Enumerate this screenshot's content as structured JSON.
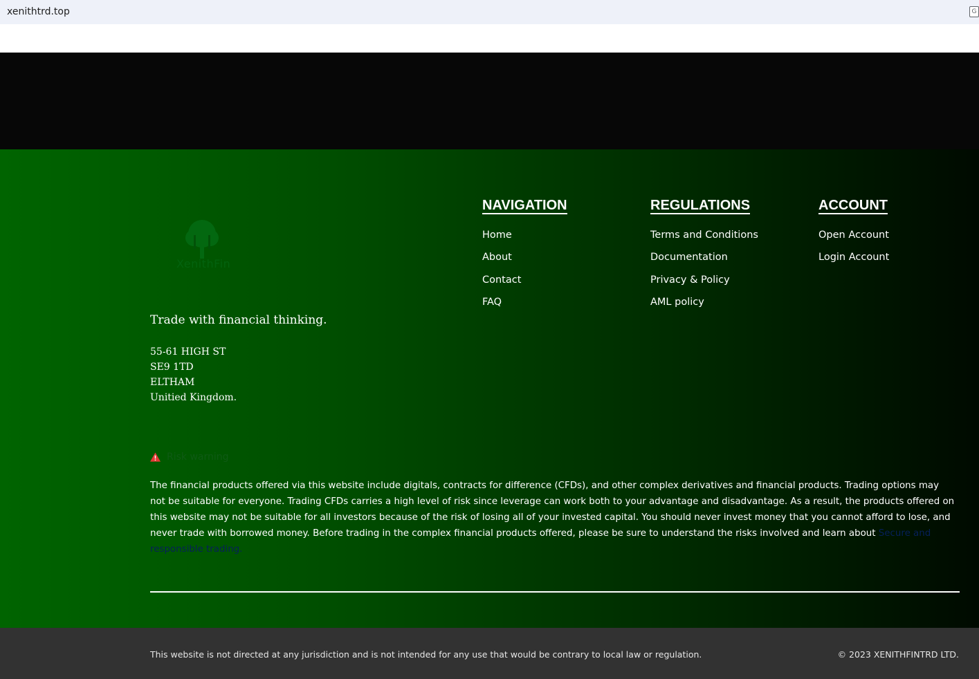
{
  "browser": {
    "url": "xenithtrd.top"
  },
  "footer": {
    "logo_text": "XenithFin",
    "tagline": "Trade with financial thinking.",
    "address": [
      "55-61 HIGH ST",
      "SE9 1TD",
      "ELTHAM",
      "Unitied Kingdom."
    ],
    "navigation": {
      "heading": "NAVIGATION",
      "items": [
        "Home",
        "About",
        "Contact",
        "FAQ"
      ]
    },
    "regulations": {
      "heading": "REGULATIONS",
      "items": [
        "Terms and Conditions",
        "Documentation",
        "Privacy & Policy",
        "AML policy"
      ]
    },
    "account": {
      "heading": "ACCOUNT",
      "items": [
        "Open Account",
        "Login Account"
      ]
    },
    "risk": {
      "heading": "Risk warning",
      "text": "The financial products offered via this website include digitals, contracts for difference (CFDs), and other complex derivatives and financial products. Trading options may not be suitable for everyone. Trading CFDs carries a high level of risk since leverage can work both to your advantage and disadvantage. As a result, the products offered on this website may not be suitable for all investors because of the risk of losing all of your invested capital. You should never invest money that you cannot afford to lose, and never trade with borrowed money. Before trading in the complex financial products offered, please be sure to understand the risks involved and learn about ",
      "link_text": "Secure and responsible trading."
    }
  },
  "bottom_bar": {
    "disclaimer": "This website is not directed at any jurisdiction and is not intended for any use that would be contrary to local law or regulation.",
    "copyright": "© 2023 XENITHFINTRD LTD."
  },
  "colors": {
    "footer_gradient_start": "#006400",
    "footer_gradient_end": "#000a00",
    "bottom_bar": "#323232",
    "warning": "#e53935"
  }
}
